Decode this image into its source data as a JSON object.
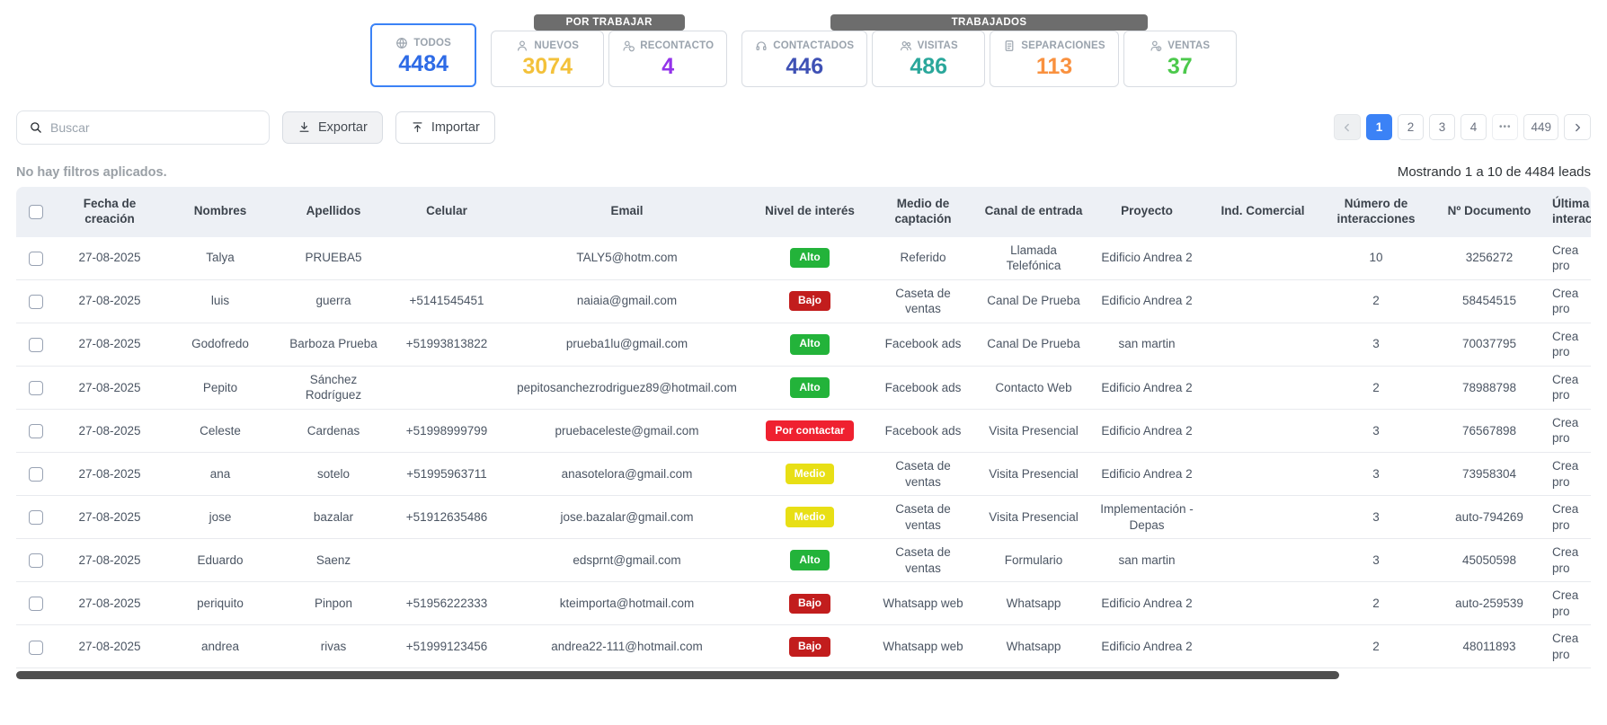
{
  "stats": {
    "todos": {
      "label": "TODOS",
      "value": "4484",
      "color": "#2e6be6",
      "icon": "globe-icon"
    },
    "groups": [
      {
        "label": "POR TRABAJAR",
        "cards": [
          {
            "label": "NUEVOS",
            "value": "3074",
            "color": "#f3c13a",
            "icon": "new-person-icon"
          },
          {
            "label": "RECONTACTO",
            "value": "4",
            "color": "#9333ea",
            "icon": "recontact-icon"
          }
        ]
      },
      {
        "label": "TRABAJADOS",
        "cards": [
          {
            "label": "CONTACTADOS",
            "value": "446",
            "color": "#3f51b5",
            "icon": "headset-icon"
          },
          {
            "label": "VISITAS",
            "value": "486",
            "color": "#2aa79b",
            "icon": "visit-icon"
          },
          {
            "label": "SEPARACIONES",
            "value": "113",
            "color": "#f9913f",
            "icon": "separation-icon"
          },
          {
            "label": "VENTAS",
            "value": "37",
            "color": "#4cc94c",
            "icon": "sale-icon"
          }
        ]
      }
    ]
  },
  "toolbar": {
    "search_placeholder": "Buscar",
    "export_label": "Exportar",
    "import_label": "Importar"
  },
  "pagination": {
    "items": [
      {
        "label": "1",
        "active": true
      },
      {
        "label": "2"
      },
      {
        "label": "3"
      },
      {
        "label": "4"
      },
      {
        "label": "•••",
        "ellipsis": true
      },
      {
        "label": "449"
      }
    ]
  },
  "status": {
    "filters": "No hay filtros aplicados.",
    "showing": "Mostrando 1 a 10 de 4484 leads"
  },
  "table": {
    "columns": [
      {
        "key": "fecha",
        "label": "Fecha de creación"
      },
      {
        "key": "nombres",
        "label": "Nombres"
      },
      {
        "key": "apellidos",
        "label": "Apellidos"
      },
      {
        "key": "celular",
        "label": "Celular"
      },
      {
        "key": "email",
        "label": "Email"
      },
      {
        "key": "interes",
        "label": "Nivel de interés"
      },
      {
        "key": "medio",
        "label": "Medio de captación"
      },
      {
        "key": "canal",
        "label": "Canal de entrada"
      },
      {
        "key": "proyecto",
        "label": "Proyecto"
      },
      {
        "key": "ind",
        "label": "Ind. Comercial"
      },
      {
        "key": "num",
        "label": "Número de interacciones"
      },
      {
        "key": "doc",
        "label": "Nº Documento"
      },
      {
        "key": "ultima",
        "label": "Última interacción"
      }
    ],
    "interes_colors": {
      "Alto": "#23b33a",
      "Medio": "#e8df15",
      "Bajo": "#c21d1d",
      "Por contactar": "#ef2130"
    },
    "rows": [
      {
        "fecha": "27-08-2025",
        "nombres": "Talya",
        "apellidos": "PRUEBA5",
        "celular": "",
        "email": "TALY5@hotm.com",
        "interes": "Alto",
        "medio": "Referido",
        "canal": "Llamada Telefónica",
        "proyecto": "Edificio Andrea 2",
        "ind": "",
        "num": "10",
        "doc": "3256272",
        "ultima": "Crea pro"
      },
      {
        "fecha": "27-08-2025",
        "nombres": "luis",
        "apellidos": "guerra",
        "celular": "+5141545451",
        "email": "naiaia@gmail.com",
        "interes": "Bajo",
        "medio": "Caseta de ventas",
        "canal": "Canal De Prueba",
        "proyecto": "Edificio Andrea 2",
        "ind": "",
        "num": "2",
        "doc": "58454515",
        "ultima": "Crea pro"
      },
      {
        "fecha": "27-08-2025",
        "nombres": "Godofredo",
        "apellidos": "Barboza Prueba",
        "celular": "+51993813822",
        "email": "prueba1lu@gmail.com",
        "interes": "Alto",
        "medio": "Facebook ads",
        "canal": "Canal De Prueba",
        "proyecto": "san martin",
        "ind": "",
        "num": "3",
        "doc": "70037795",
        "ultima": "Crea pro"
      },
      {
        "fecha": "27-08-2025",
        "nombres": "Pepito",
        "apellidos": "Sánchez Rodríguez",
        "celular": "",
        "email": "pepitosanchezrodriguez89@hotmail.com",
        "interes": "Alto",
        "medio": "Facebook ads",
        "canal": "Contacto Web",
        "proyecto": "Edificio Andrea 2",
        "ind": "",
        "num": "2",
        "doc": "78988798",
        "ultima": "Crea pro"
      },
      {
        "fecha": "27-08-2025",
        "nombres": "Celeste",
        "apellidos": "Cardenas",
        "celular": "+51998999799",
        "email": "pruebaceleste@gmail.com",
        "interes": "Por contactar",
        "medio": "Facebook ads",
        "canal": "Visita Presencial",
        "proyecto": "Edificio Andrea 2",
        "ind": "",
        "num": "3",
        "doc": "76567898",
        "ultima": "Crea pro"
      },
      {
        "fecha": "27-08-2025",
        "nombres": "ana",
        "apellidos": "sotelo",
        "celular": "+51995963711",
        "email": "anasotelora@gmail.com",
        "interes": "Medio",
        "medio": "Caseta de ventas",
        "canal": "Visita Presencial",
        "proyecto": "Edificio Andrea 2",
        "ind": "",
        "num": "3",
        "doc": "73958304",
        "ultima": "Crea pro"
      },
      {
        "fecha": "27-08-2025",
        "nombres": "jose",
        "apellidos": "bazalar",
        "celular": "+51912635486",
        "email": "jose.bazalar@gmail.com",
        "interes": "Medio",
        "medio": "Caseta de ventas",
        "canal": "Visita Presencial",
        "proyecto": "Implementación - Depas",
        "ind": "",
        "num": "3",
        "doc": "auto-794269",
        "ultima": "Crea pro"
      },
      {
        "fecha": "27-08-2025",
        "nombres": "Eduardo",
        "apellidos": "Saenz",
        "celular": "",
        "email": "edsprnt@gmail.com",
        "interes": "Alto",
        "medio": "Caseta de ventas",
        "canal": "Formulario",
        "proyecto": "san martin",
        "ind": "",
        "num": "3",
        "doc": "45050598",
        "ultima": "Crea pro"
      },
      {
        "fecha": "27-08-2025",
        "nombres": "periquito",
        "apellidos": "Pinpon",
        "celular": "+51956222333",
        "email": "kteimporta@hotmail.com",
        "interes": "Bajo",
        "medio": "Whatsapp web",
        "canal": "Whatsapp",
        "proyecto": "Edificio Andrea 2",
        "ind": "",
        "num": "2",
        "doc": "auto-259539",
        "ultima": "Crea pro"
      },
      {
        "fecha": "27-08-2025",
        "nombres": "andrea",
        "apellidos": "rivas",
        "celular": "+51999123456",
        "email": "andrea22-111@hotmail.com",
        "interes": "Bajo",
        "medio": "Whatsapp web",
        "canal": "Whatsapp",
        "proyecto": "Edificio Andrea 2",
        "ind": "",
        "num": "2",
        "doc": "48011893",
        "ultima": "Crea pro"
      }
    ]
  }
}
